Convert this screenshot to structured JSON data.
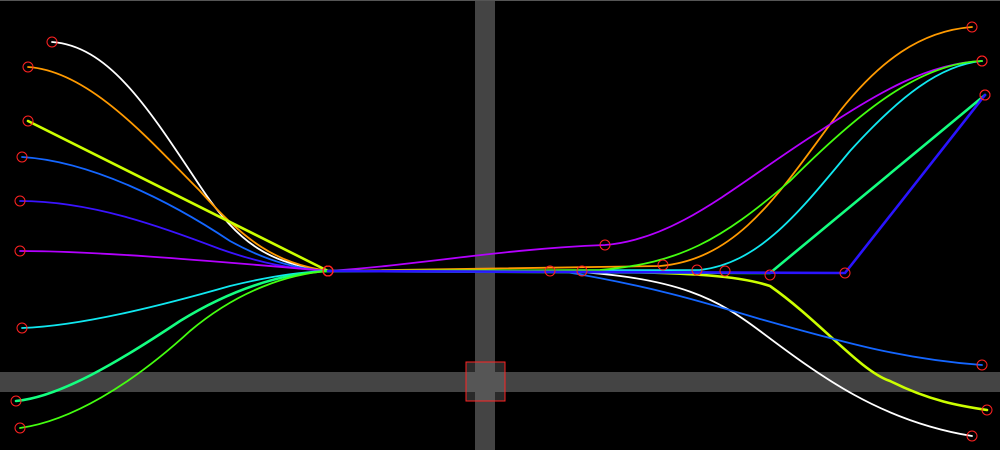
{
  "canvas": {
    "background": "#000000"
  },
  "guides": {
    "band_color": "#444444",
    "vertical_band": "shown",
    "horizontal_band": "shown",
    "crosshair_box_color": "#ff2222"
  },
  "node_marker": {
    "shape": "circle-outline",
    "color": "#ff2222"
  },
  "curves": [
    {
      "name": "white",
      "color": "#ffffff"
    },
    {
      "name": "orange",
      "color": "#ff9a00"
    },
    {
      "name": "yellow-green",
      "color": "#ccff00"
    },
    {
      "name": "blue",
      "color": "#1466ff"
    },
    {
      "name": "indigo",
      "color": "#3a14ff"
    },
    {
      "name": "purple",
      "color": "#b400ff"
    },
    {
      "name": "cyan",
      "color": "#10e8f0"
    },
    {
      "name": "spring-green",
      "color": "#14ff80"
    },
    {
      "name": "lime",
      "color": "#44ff10"
    },
    {
      "name": "bright-blue",
      "color": "#2a14ff"
    }
  ]
}
